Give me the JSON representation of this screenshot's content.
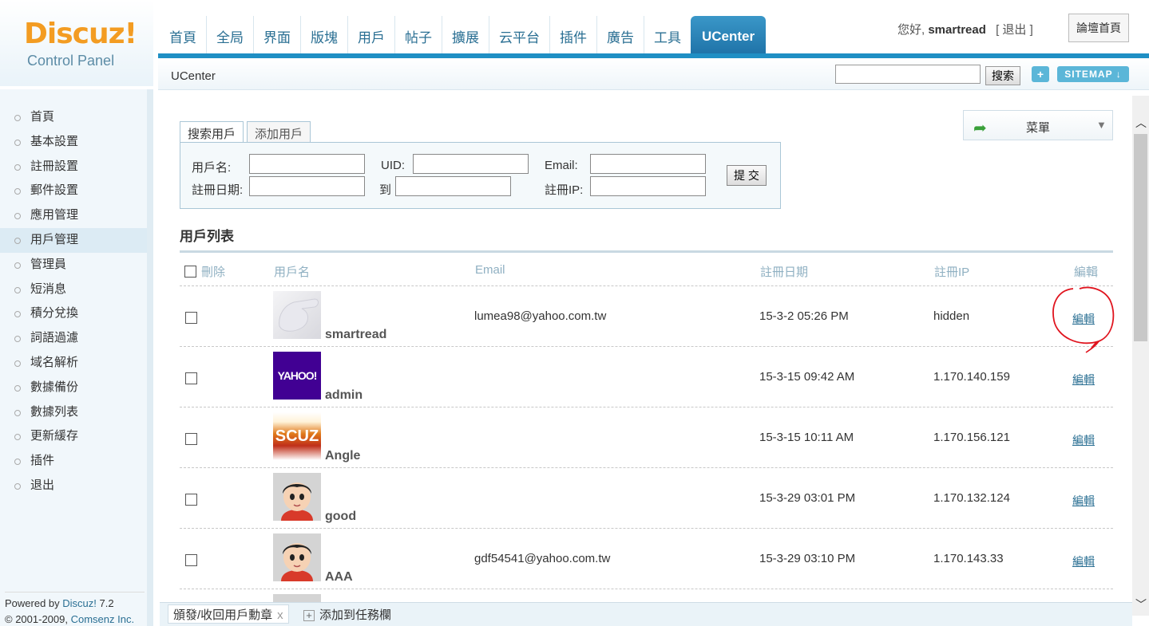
{
  "logo": {
    "brand": "Discuz!",
    "sub": "Control Panel"
  },
  "nav": [
    {
      "label": "首頁"
    },
    {
      "label": "全局"
    },
    {
      "label": "界面"
    },
    {
      "label": "版塊"
    },
    {
      "label": "用戶"
    },
    {
      "label": "帖子"
    },
    {
      "label": "擴展"
    },
    {
      "label": "云平台"
    },
    {
      "label": "插件"
    },
    {
      "label": "廣告"
    },
    {
      "label": "工具"
    },
    {
      "label": "UCenter"
    }
  ],
  "header": {
    "greeting_prefix": "您好,",
    "username": "smartread",
    "logout": "[ 退出 ]",
    "forum_home": "論壇首頁",
    "breadcrumb": "UCenter",
    "search_button": "搜索",
    "plus": "+",
    "sitemap": "SITEMAP ↓"
  },
  "sidebar": {
    "items": [
      {
        "label": "首頁"
      },
      {
        "label": "基本設置"
      },
      {
        "label": "註冊設置"
      },
      {
        "label": "郵件設置"
      },
      {
        "label": "應用管理"
      },
      {
        "label": "用戶管理"
      },
      {
        "label": "管理員"
      },
      {
        "label": "短消息"
      },
      {
        "label": "積分兌換"
      },
      {
        "label": "詞語過濾"
      },
      {
        "label": "域名解析"
      },
      {
        "label": "數據備份"
      },
      {
        "label": "數據列表"
      },
      {
        "label": "更新緩存"
      },
      {
        "label": "插件"
      },
      {
        "label": "退出"
      }
    ],
    "powered_prefix": "Powered by ",
    "powered_link": "Discuz!",
    "powered_version": " 7.2",
    "copyright_prefix": "© 2001-2009, ",
    "copyright_link": "Comsenz Inc."
  },
  "menu": {
    "label": "菜單"
  },
  "tabs": [
    {
      "label": "搜索用戶"
    },
    {
      "label": "添加用戶"
    }
  ],
  "form": {
    "username_label": "用戶名:",
    "uid_label": "UID:",
    "email_label": "Email:",
    "regdate_label": "註冊日期:",
    "to_label": "到",
    "regip_label": "註冊IP:",
    "submit": "提 交"
  },
  "list": {
    "title": "用戶列表",
    "headers": {
      "delete": "刪除",
      "username": "用戶名",
      "email": "Email",
      "regdate": "註冊日期",
      "regip": "註冊IP",
      "edit": "編輯"
    },
    "rows": [
      {
        "username": "smartread",
        "email": "lumea98@yahoo.com.tw",
        "date": "15-3-2 05:26 PM",
        "ip": "hidden",
        "edit": "編輯",
        "avatar_text": ""
      },
      {
        "username": "admin",
        "email": "",
        "date": "15-3-15 09:42 AM",
        "ip": "1.170.140.159",
        "edit": "編輯",
        "avatar_text": "YAHOO!"
      },
      {
        "username": "Angle",
        "email": "",
        "date": "15-3-15 10:11 AM",
        "ip": "1.170.156.121",
        "edit": "編輯",
        "avatar_text": "SCUZ"
      },
      {
        "username": "good",
        "email": "",
        "date": "15-3-29 03:01 PM",
        "ip": "1.170.132.124",
        "edit": "編輯",
        "avatar_text": ""
      },
      {
        "username": "AAA",
        "email": "gdf54541@yahoo.com.tw",
        "date": "15-3-29 03:10 PM",
        "ip": "1.170.143.33",
        "edit": "編輯",
        "avatar_text": ""
      }
    ]
  },
  "taskbar": {
    "task1": "頒發/收回用戶勳章",
    "close": "x",
    "add": "添加到任務欄"
  },
  "colors": {
    "accent": "#1f8fc4",
    "link": "#2a6f93",
    "logo": "#f39c22",
    "annotation": "#e0141e"
  }
}
